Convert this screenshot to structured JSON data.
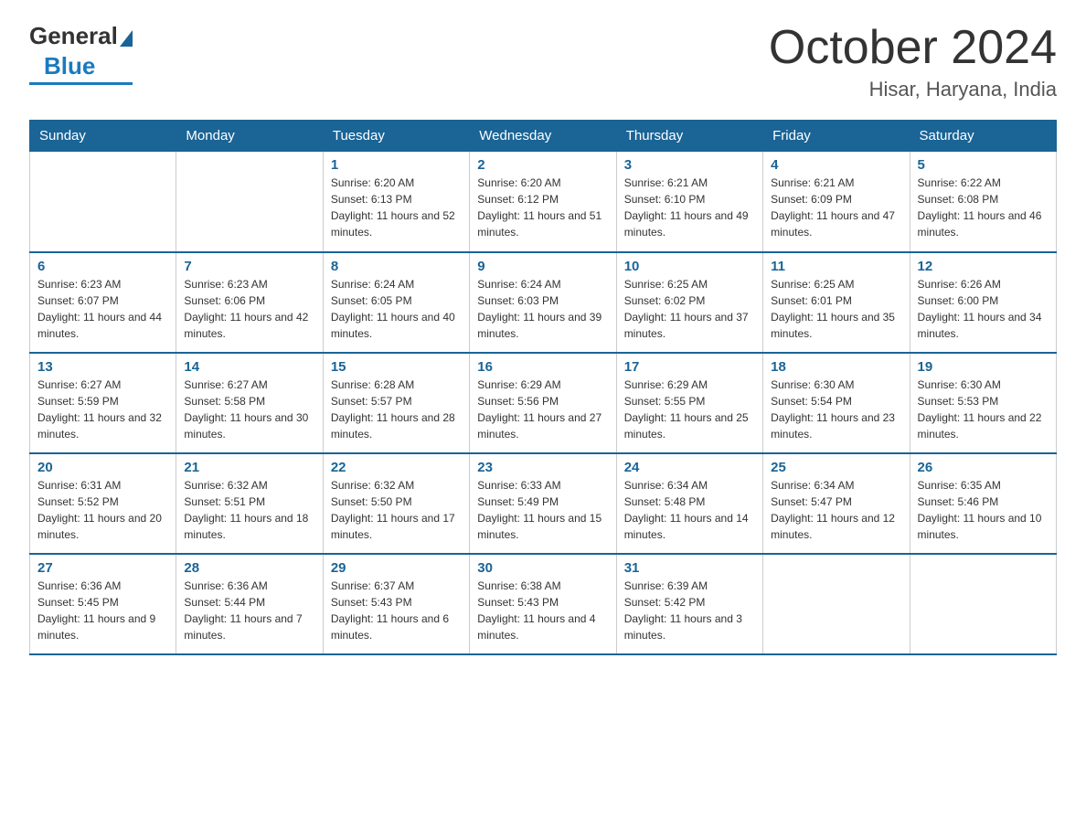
{
  "logo": {
    "general": "General",
    "blue": "Blue"
  },
  "title": "October 2024",
  "location": "Hisar, Haryana, India",
  "days_header": [
    "Sunday",
    "Monday",
    "Tuesday",
    "Wednesday",
    "Thursday",
    "Friday",
    "Saturday"
  ],
  "weeks": [
    [
      {
        "day": "",
        "sunrise": "",
        "sunset": "",
        "daylight": ""
      },
      {
        "day": "",
        "sunrise": "",
        "sunset": "",
        "daylight": ""
      },
      {
        "day": "1",
        "sunrise": "Sunrise: 6:20 AM",
        "sunset": "Sunset: 6:13 PM",
        "daylight": "Daylight: 11 hours and 52 minutes."
      },
      {
        "day": "2",
        "sunrise": "Sunrise: 6:20 AM",
        "sunset": "Sunset: 6:12 PM",
        "daylight": "Daylight: 11 hours and 51 minutes."
      },
      {
        "day": "3",
        "sunrise": "Sunrise: 6:21 AM",
        "sunset": "Sunset: 6:10 PM",
        "daylight": "Daylight: 11 hours and 49 minutes."
      },
      {
        "day": "4",
        "sunrise": "Sunrise: 6:21 AM",
        "sunset": "Sunset: 6:09 PM",
        "daylight": "Daylight: 11 hours and 47 minutes."
      },
      {
        "day": "5",
        "sunrise": "Sunrise: 6:22 AM",
        "sunset": "Sunset: 6:08 PM",
        "daylight": "Daylight: 11 hours and 46 minutes."
      }
    ],
    [
      {
        "day": "6",
        "sunrise": "Sunrise: 6:23 AM",
        "sunset": "Sunset: 6:07 PM",
        "daylight": "Daylight: 11 hours and 44 minutes."
      },
      {
        "day": "7",
        "sunrise": "Sunrise: 6:23 AM",
        "sunset": "Sunset: 6:06 PM",
        "daylight": "Daylight: 11 hours and 42 minutes."
      },
      {
        "day": "8",
        "sunrise": "Sunrise: 6:24 AM",
        "sunset": "Sunset: 6:05 PM",
        "daylight": "Daylight: 11 hours and 40 minutes."
      },
      {
        "day": "9",
        "sunrise": "Sunrise: 6:24 AM",
        "sunset": "Sunset: 6:03 PM",
        "daylight": "Daylight: 11 hours and 39 minutes."
      },
      {
        "day": "10",
        "sunrise": "Sunrise: 6:25 AM",
        "sunset": "Sunset: 6:02 PM",
        "daylight": "Daylight: 11 hours and 37 minutes."
      },
      {
        "day": "11",
        "sunrise": "Sunrise: 6:25 AM",
        "sunset": "Sunset: 6:01 PM",
        "daylight": "Daylight: 11 hours and 35 minutes."
      },
      {
        "day": "12",
        "sunrise": "Sunrise: 6:26 AM",
        "sunset": "Sunset: 6:00 PM",
        "daylight": "Daylight: 11 hours and 34 minutes."
      }
    ],
    [
      {
        "day": "13",
        "sunrise": "Sunrise: 6:27 AM",
        "sunset": "Sunset: 5:59 PM",
        "daylight": "Daylight: 11 hours and 32 minutes."
      },
      {
        "day": "14",
        "sunrise": "Sunrise: 6:27 AM",
        "sunset": "Sunset: 5:58 PM",
        "daylight": "Daylight: 11 hours and 30 minutes."
      },
      {
        "day": "15",
        "sunrise": "Sunrise: 6:28 AM",
        "sunset": "Sunset: 5:57 PM",
        "daylight": "Daylight: 11 hours and 28 minutes."
      },
      {
        "day": "16",
        "sunrise": "Sunrise: 6:29 AM",
        "sunset": "Sunset: 5:56 PM",
        "daylight": "Daylight: 11 hours and 27 minutes."
      },
      {
        "day": "17",
        "sunrise": "Sunrise: 6:29 AM",
        "sunset": "Sunset: 5:55 PM",
        "daylight": "Daylight: 11 hours and 25 minutes."
      },
      {
        "day": "18",
        "sunrise": "Sunrise: 6:30 AM",
        "sunset": "Sunset: 5:54 PM",
        "daylight": "Daylight: 11 hours and 23 minutes."
      },
      {
        "day": "19",
        "sunrise": "Sunrise: 6:30 AM",
        "sunset": "Sunset: 5:53 PM",
        "daylight": "Daylight: 11 hours and 22 minutes."
      }
    ],
    [
      {
        "day": "20",
        "sunrise": "Sunrise: 6:31 AM",
        "sunset": "Sunset: 5:52 PM",
        "daylight": "Daylight: 11 hours and 20 minutes."
      },
      {
        "day": "21",
        "sunrise": "Sunrise: 6:32 AM",
        "sunset": "Sunset: 5:51 PM",
        "daylight": "Daylight: 11 hours and 18 minutes."
      },
      {
        "day": "22",
        "sunrise": "Sunrise: 6:32 AM",
        "sunset": "Sunset: 5:50 PM",
        "daylight": "Daylight: 11 hours and 17 minutes."
      },
      {
        "day": "23",
        "sunrise": "Sunrise: 6:33 AM",
        "sunset": "Sunset: 5:49 PM",
        "daylight": "Daylight: 11 hours and 15 minutes."
      },
      {
        "day": "24",
        "sunrise": "Sunrise: 6:34 AM",
        "sunset": "Sunset: 5:48 PM",
        "daylight": "Daylight: 11 hours and 14 minutes."
      },
      {
        "day": "25",
        "sunrise": "Sunrise: 6:34 AM",
        "sunset": "Sunset: 5:47 PM",
        "daylight": "Daylight: 11 hours and 12 minutes."
      },
      {
        "day": "26",
        "sunrise": "Sunrise: 6:35 AM",
        "sunset": "Sunset: 5:46 PM",
        "daylight": "Daylight: 11 hours and 10 minutes."
      }
    ],
    [
      {
        "day": "27",
        "sunrise": "Sunrise: 6:36 AM",
        "sunset": "Sunset: 5:45 PM",
        "daylight": "Daylight: 11 hours and 9 minutes."
      },
      {
        "day": "28",
        "sunrise": "Sunrise: 6:36 AM",
        "sunset": "Sunset: 5:44 PM",
        "daylight": "Daylight: 11 hours and 7 minutes."
      },
      {
        "day": "29",
        "sunrise": "Sunrise: 6:37 AM",
        "sunset": "Sunset: 5:43 PM",
        "daylight": "Daylight: 11 hours and 6 minutes."
      },
      {
        "day": "30",
        "sunrise": "Sunrise: 6:38 AM",
        "sunset": "Sunset: 5:43 PM",
        "daylight": "Daylight: 11 hours and 4 minutes."
      },
      {
        "day": "31",
        "sunrise": "Sunrise: 6:39 AM",
        "sunset": "Sunset: 5:42 PM",
        "daylight": "Daylight: 11 hours and 3 minutes."
      },
      {
        "day": "",
        "sunrise": "",
        "sunset": "",
        "daylight": ""
      },
      {
        "day": "",
        "sunrise": "",
        "sunset": "",
        "daylight": ""
      }
    ]
  ]
}
